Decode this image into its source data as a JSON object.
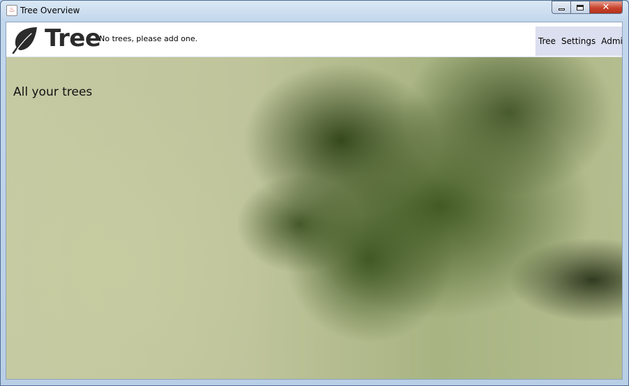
{
  "window": {
    "title": "Tree Overview",
    "app_icon": "java-cup-icon",
    "controls": {
      "minimize_icon": "minimize-icon",
      "maximize_icon": "maximize-icon",
      "close_icon": "close-icon",
      "close_glyph": "✕"
    }
  },
  "header": {
    "logo_icon": "leaf-icon",
    "brand": "Tree",
    "status": "No trees, please add one.",
    "nav": [
      {
        "label": "Tree"
      },
      {
        "label": "Settings"
      },
      {
        "label": "Admin"
      }
    ]
  },
  "main": {
    "title": "All your trees"
  },
  "colors": {
    "header_bg": "#ffffff",
    "nav_bg": "#dcdfef",
    "close_button": "#c8432c"
  }
}
